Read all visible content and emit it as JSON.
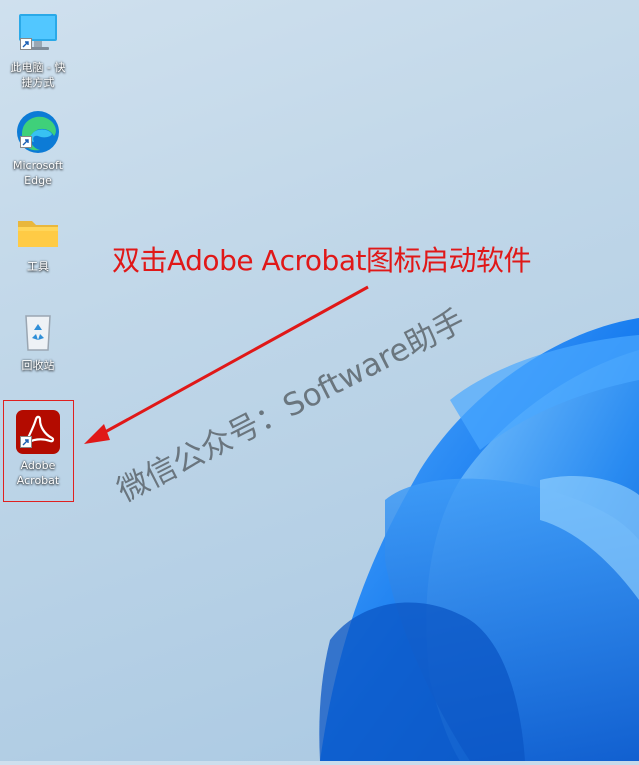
{
  "desktop": {
    "icons": [
      {
        "label_line1": "此电脑 - 快",
        "label_line2": "捷方式",
        "icon": "this-pc-icon"
      },
      {
        "label_line1": "Microsoft",
        "label_line2": "Edge",
        "icon": "edge-icon"
      },
      {
        "label_line1": "工具",
        "label_line2": "",
        "icon": "folder-icon"
      },
      {
        "label_line1": "回收站",
        "label_line2": "",
        "icon": "recycle-bin-icon"
      },
      {
        "label_line1": "Adobe",
        "label_line2": "Acrobat",
        "icon": "adobe-acrobat-icon"
      }
    ]
  },
  "annotation": {
    "text": "双击Adobe Acrobat图标启动软件",
    "color": "#e01818"
  },
  "watermark": {
    "text": "微信公众号：Software助手"
  },
  "colors": {
    "highlight": "#e02020",
    "acrobat_red": "#b30b00",
    "wallpaper_blue": "#1e7fe6"
  }
}
